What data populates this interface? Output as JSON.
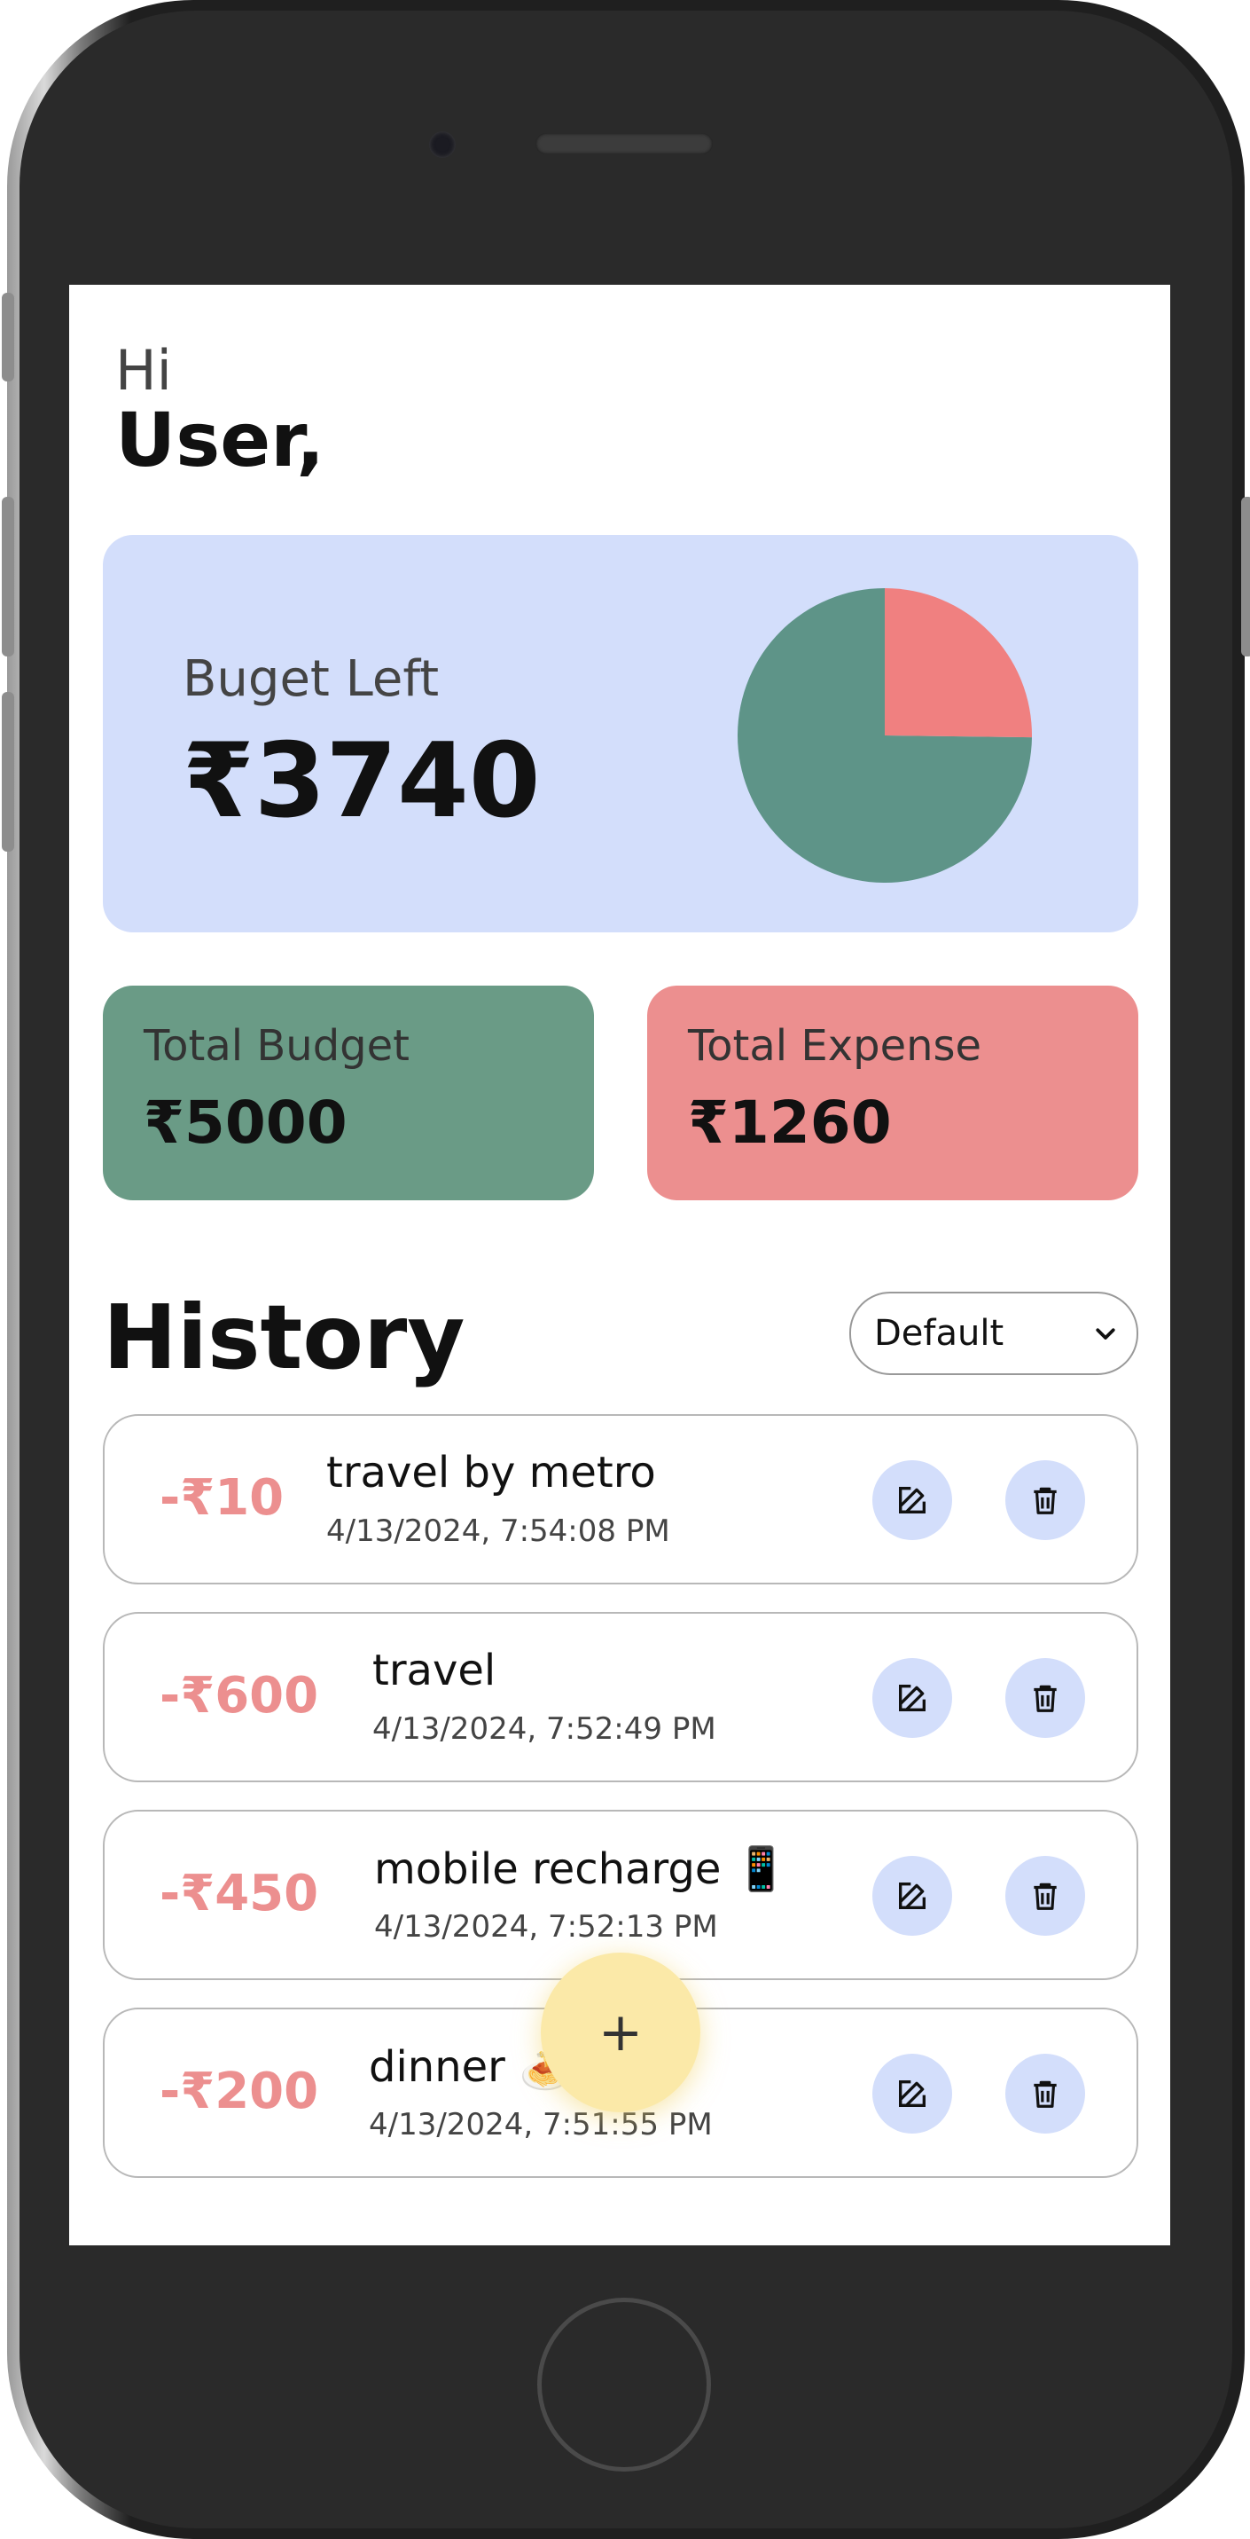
{
  "greeting": {
    "hi": "Hi",
    "user": "User,"
  },
  "budget_left": {
    "label": "Buget Left",
    "value": "₹3740",
    "used_fraction": 0.252
  },
  "totals": {
    "budget": {
      "label": "Total Budget",
      "value": "₹5000"
    },
    "expense": {
      "label": "Total Expense",
      "value": "₹1260"
    }
  },
  "history": {
    "title": "History",
    "sort": {
      "selected": "Default"
    },
    "items": [
      {
        "amount": "-₹10",
        "title": "travel by metro",
        "date": "4/13/2024, 7:54:08 PM"
      },
      {
        "amount": "-₹600",
        "title": "travel",
        "date": "4/13/2024, 7:52:49 PM"
      },
      {
        "amount": "-₹450",
        "title": "mobile recharge 📱",
        "date": "4/13/2024, 7:52:13 PM"
      },
      {
        "amount": "-₹200",
        "title": "dinner 🍝",
        "date": "4/13/2024, 7:51:55 PM"
      }
    ]
  },
  "fab": {
    "label": "+"
  },
  "colors": {
    "remaining": "#5e9488",
    "spent": "#f08080",
    "card_blue": "#d3defb",
    "card_green": "#6a9b86",
    "card_red": "#ec8f8f",
    "amount_red": "#ec8f8f",
    "fab": "#fbe9a8"
  },
  "icons": {
    "edit": "edit-icon",
    "delete": "trash-icon",
    "sort": "chevron-down-icon",
    "add": "plus-icon"
  }
}
